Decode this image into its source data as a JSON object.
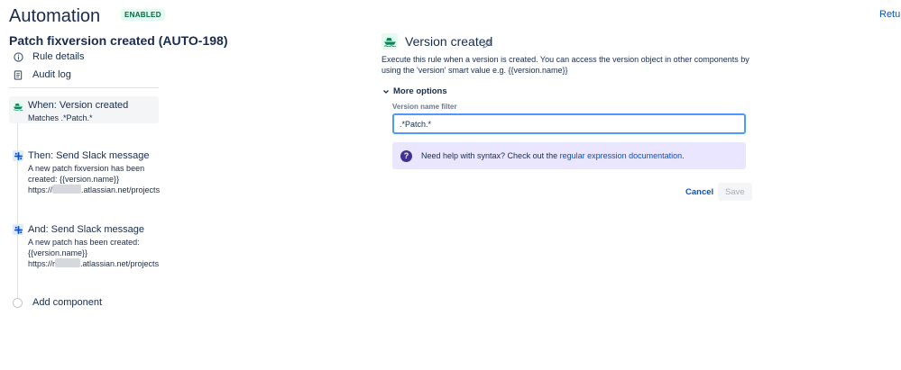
{
  "header": {
    "title": "Automation",
    "status_badge": "ENABLED",
    "return_link": "Retur"
  },
  "rule": {
    "name": "Patch fixversion created (AUTO-198)"
  },
  "nav": {
    "items": [
      {
        "label": "Rule details",
        "icon": "info-icon"
      },
      {
        "label": "Audit log",
        "icon": "document-icon"
      }
    ]
  },
  "steps": [
    {
      "title": "When: Version created",
      "lines": [
        "Matches .*Patch.*"
      ],
      "icon": "ship-icon",
      "color": "#36b37e"
    },
    {
      "title": "Then: Send Slack message",
      "lines": [
        "A new patch fixversion has been",
        "created: {{version.name}}",
        "https://",
        ".atlassian.net/projects"
      ],
      "icon": "slack-icon",
      "color": "#4c9aff"
    },
    {
      "title": "And: Send Slack message",
      "lines": [
        "A new patch has been created:",
        "{{version.name}}",
        "https://r",
        ".atlassian.net/projects"
      ],
      "icon": "slack-icon",
      "color": "#4c9aff"
    }
  ],
  "add_component": "Add component",
  "panel": {
    "title": "Version created",
    "description": "Execute this rule when a version is created. You can access the version object in other components by using the 'version' smart value e.g. {{version.name}}",
    "more_options": "More options",
    "field_label": "Version name filter",
    "field_value": ".*Patch.*",
    "help_text": "Need help with syntax? Check out the ",
    "help_link": "regular expression documentation",
    "help_suffix": ".",
    "cancel_label": "Cancel",
    "save_label": "Save"
  },
  "colors": {
    "accent": "#0052cc",
    "success": "#36b37e",
    "help_bg": "#eae6ff"
  }
}
